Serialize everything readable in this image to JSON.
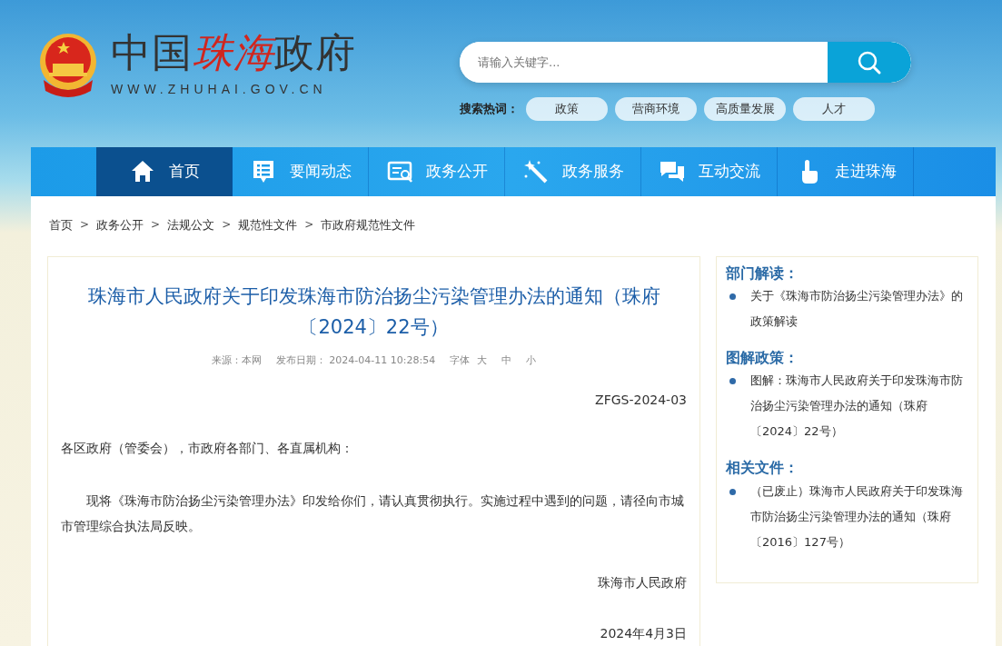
{
  "logo": {
    "parts": [
      {
        "text": "中国",
        "kind": "plain"
      },
      {
        "text": "珠海",
        "kind": "accent"
      },
      {
        "text": "政府",
        "kind": "plain"
      }
    ],
    "url": "WWW.ZHUHAI.GOV.CN"
  },
  "search": {
    "placeholder": "请输入关键字..."
  },
  "hot_words": {
    "label": "搜索热词：",
    "items": [
      "政策",
      "营商环境",
      "高质量发展",
      "人才"
    ]
  },
  "nav": [
    {
      "label": "首页",
      "selected": true
    },
    {
      "label": "要闻动态",
      "selected": false
    },
    {
      "label": "政务公开",
      "selected": false
    },
    {
      "label": "政务服务",
      "selected": false
    },
    {
      "label": "互动交流",
      "selected": false
    },
    {
      "label": "走进珠海",
      "selected": false
    }
  ],
  "breadcrumb": [
    {
      "label": "首页"
    },
    {
      "separator": ">",
      "label": "政务公开"
    },
    {
      "separator": ">",
      "label": "法规公文"
    },
    {
      "separator": ">",
      "label": "规范性文件"
    },
    {
      "separator": ">",
      "label": "市政府规范性文件"
    }
  ],
  "article": {
    "title": "珠海市人民政府关于印发珠海市防治扬尘污染管理办法的通知（珠府〔2024〕22号）",
    "source": "来源：本网",
    "published": "发布日期： 2024-04-11 10:28:54",
    "font_label": "字体",
    "font_sizes": [
      "大",
      "中",
      "小"
    ],
    "doc_number": "ZFGS-2024-03",
    "addressee": "各区政府（管委会），市政府各部门、各直属机构：",
    "body": "现将《珠海市防治扬尘污染管理办法》印发给你们，请认真贯彻执行。实施过程中遇到的问题，请径向市城市管理综合执法局反映。",
    "signer": "珠海市人民政府",
    "date": "2024年4月3日"
  },
  "sidebar": [
    {
      "title": "部门解读：",
      "items": [
        "关于《珠海市防治扬尘污染管理办法》的政策解读"
      ]
    },
    {
      "title": "图解政策：",
      "items": [
        "图解：珠海市人民政府关于印发珠海市防治扬尘污染管理办法的通知（珠府〔2024〕22号）"
      ]
    },
    {
      "title": "相关文件：",
      "items": [
        "（已废止）珠海市人民政府关于印发珠海市防治扬尘污染管理办法的通知（珠府〔2016〕127号）"
      ]
    }
  ]
}
